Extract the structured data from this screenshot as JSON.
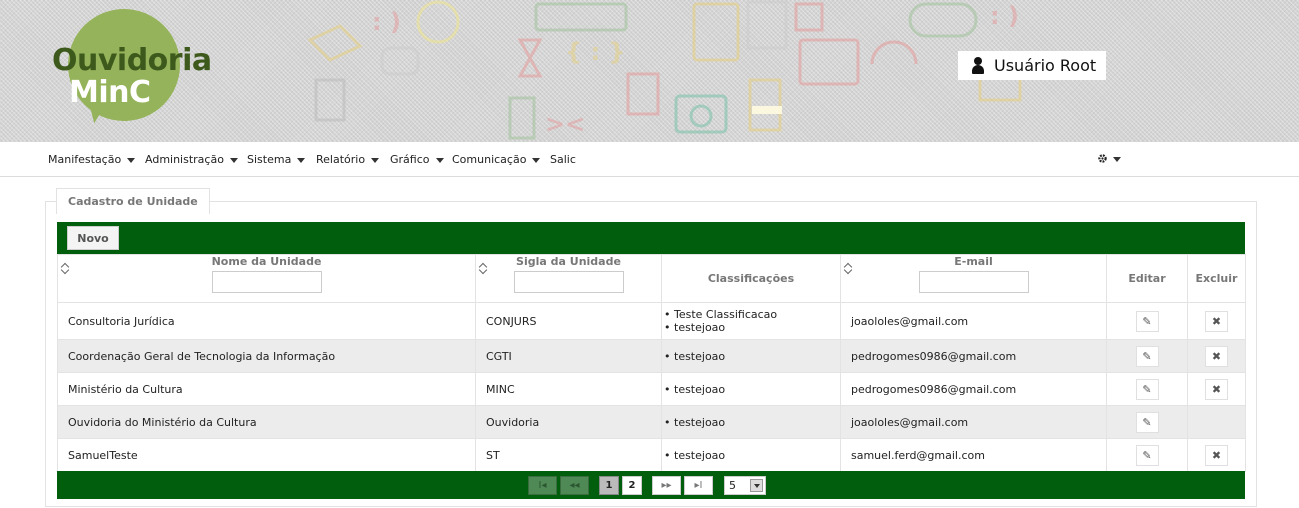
{
  "header": {
    "logo": {
      "line1": "Ouvidoria",
      "line2": "MinC"
    },
    "user": {
      "name": "Usuário Root",
      "icon": "user-icon"
    },
    "colors": {
      "logo_green": "#95b35a",
      "logo_dark": "#3d5a1c",
      "bar_green": "#005e0d"
    }
  },
  "menu": {
    "items": [
      {
        "label": "Manifestação",
        "dropdown": true
      },
      {
        "label": "Administração",
        "dropdown": true
      },
      {
        "label": "Sistema",
        "dropdown": true
      },
      {
        "label": "Relatório",
        "dropdown": true
      },
      {
        "label": "Gráfico",
        "dropdown": true
      },
      {
        "label": "Comunicação",
        "dropdown": true
      },
      {
        "label": "Salic",
        "dropdown": false
      }
    ],
    "settings_icon": "gear-icon"
  },
  "panel": {
    "legend": "Cadastro de Unidade",
    "new_button": "Novo",
    "columns": {
      "nome": "Nome da Unidade",
      "sigla": "Sigla da Unidade",
      "classificacoes": "Classificações",
      "email": "E-mail",
      "editar": "Editar",
      "excluir": "Excluir"
    },
    "rows": [
      {
        "nome": "Consultoria Jurídica",
        "sigla": "CONJURS",
        "classificacoes": [
          "Teste Classificacao",
          "testejoao"
        ],
        "email": "joaololes@gmail.com",
        "can_delete": true
      },
      {
        "nome": "Coordenação Geral de Tecnologia da Informação",
        "sigla": "CGTI",
        "classificacoes": [
          "testejoao"
        ],
        "email": "pedrogomes0986@gmail.com",
        "can_delete": true
      },
      {
        "nome": "Ministério da Cultura",
        "sigla": "MINC",
        "classificacoes": [
          "testejoao"
        ],
        "email": "pedrogomes0986@gmail.com",
        "can_delete": true
      },
      {
        "nome": "Ouvidoria do Ministério da Cultura",
        "sigla": "Ouvidoria",
        "classificacoes": [
          "testejoao"
        ],
        "email": "joaololes@gmail.com",
        "can_delete": false
      },
      {
        "nome": "SamuelTeste",
        "sigla": "ST",
        "classificacoes": [
          "testejoao"
        ],
        "email": "samuel.ferd@gmail.com",
        "can_delete": true
      }
    ],
    "paginator": {
      "first": "I◂",
      "prev": "◂◂",
      "pages": [
        "1",
        "2"
      ],
      "current_page": "1",
      "next": "▸▸",
      "last": "▸I",
      "rows_per_page": "5"
    }
  }
}
